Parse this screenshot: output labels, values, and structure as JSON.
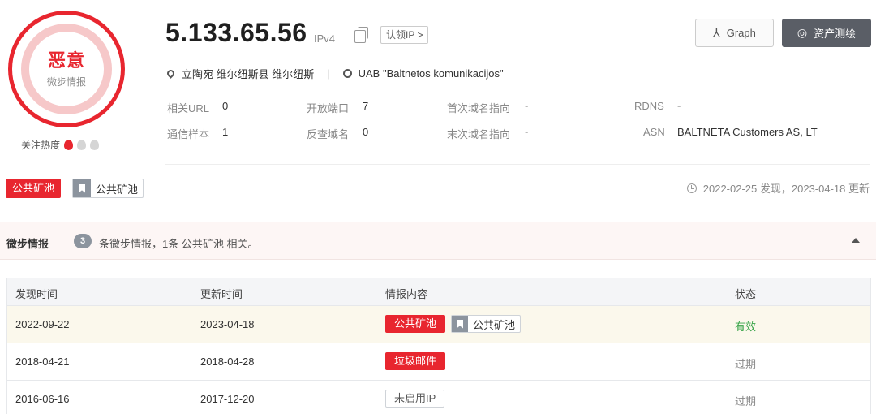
{
  "verdict": {
    "label": "恶意",
    "sublabel": "微步情报"
  },
  "heat": {
    "label": "关注热度",
    "level": 1,
    "max": 3
  },
  "header": {
    "ip": "5.133.65.56",
    "ip_version": "IPv4",
    "claim_label": "认领IP >",
    "location": "立陶宛 维尔纽斯县 维尔纽斯",
    "isp": "UAB \"Baltnetos komunikacijos\"",
    "graph_button": "Graph",
    "asset_button": "资产测绘"
  },
  "meta": {
    "related_url_label": "相关URL",
    "related_url": "0",
    "open_ports_label": "开放端口",
    "open_ports": "7",
    "first_resolve_label": "首次域名指向",
    "first_resolve": "-",
    "rdns_label": "RDNS",
    "rdns": "-",
    "samples_label": "通信样本",
    "samples": "1",
    "reverse_domains_label": "反查域名",
    "reverse_domains": "0",
    "last_resolve_label": "末次域名指向",
    "last_resolve": "-",
    "asn_label": "ASN",
    "asn": "BALTNETA Customers AS, LT"
  },
  "tags": {
    "red_tag": "公共矿池",
    "outline_tag": "公共矿池"
  },
  "update_text": "2022-02-25 发现，2023-04-18 更新",
  "intel": {
    "title": "微步情报",
    "count": "3",
    "description": "条微步情报，1条 公共矿池 相关。"
  },
  "table": {
    "headers": [
      "发现时间",
      "更新时间",
      "情报内容",
      "状态"
    ],
    "rows": [
      {
        "found": "2022-09-22",
        "updated": "2023-04-18",
        "tag_red": "公共矿池",
        "tag_outline": "公共矿池",
        "status": "有效"
      },
      {
        "found": "2018-04-21",
        "updated": "2018-04-28",
        "tag_red": "垃圾邮件",
        "status": "过期"
      },
      {
        "found": "2016-06-16",
        "updated": "2017-12-20",
        "tag_plain": "未启用IP",
        "status": "过期"
      }
    ]
  },
  "colors": {
    "danger": "#e8262f",
    "valid": "#3aa54a",
    "dark_button": "#5a5e66"
  },
  "icons": [
    "copy-icon",
    "graph-icon",
    "asset-icon",
    "location-pin-icon",
    "isp-icon",
    "flame-icon",
    "bookmark-icon",
    "clock-icon",
    "collapse-arrow-icon"
  ]
}
